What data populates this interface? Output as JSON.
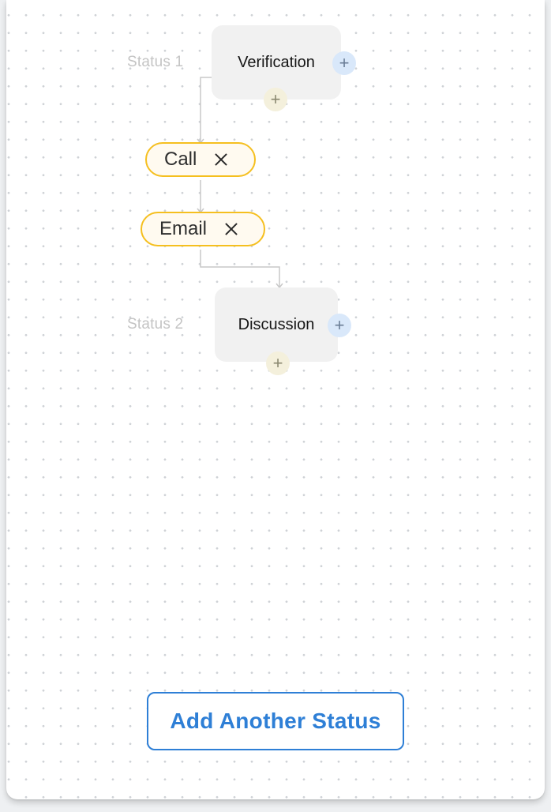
{
  "flow": {
    "statuses": [
      {
        "label": "Status 1",
        "name": "Verification",
        "add_right": "+",
        "add_below": "+"
      },
      {
        "label": "Status 2",
        "name": "Discussion",
        "add_right": "+",
        "add_below": "+"
      }
    ],
    "actions": [
      {
        "label": "Call"
      },
      {
        "label": "Email"
      }
    ]
  },
  "footer": {
    "add_status_label": "Add Another Status"
  },
  "icons": {
    "action_remove": "close-icon",
    "add_branch": "plus-icon",
    "add_action": "plus-icon"
  },
  "colors": {
    "action_border": "#f5bf1f",
    "action_fill": "#fffaf0",
    "status_fill": "#f1f1f1",
    "add_right_fill": "#d9e8fa",
    "add_below_fill": "#f4f0dc",
    "primary": "#2e7fd6"
  }
}
